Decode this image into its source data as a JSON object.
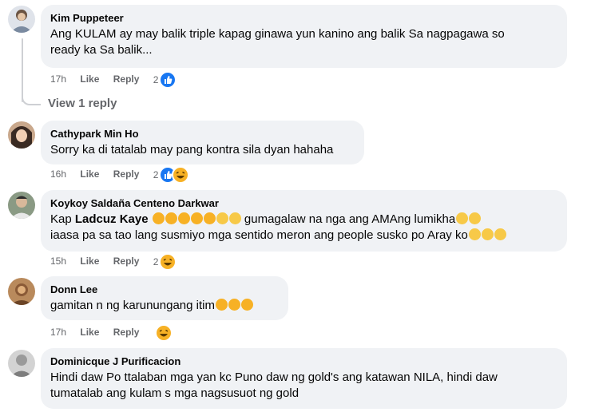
{
  "comments": [
    {
      "author": "Kim Puppeteer",
      "line1": "Ang KULAM ay may balik triple kapag ginawa yun kanino ang balik Sa nagpagawa so",
      "line2": "ready ka Sa balik...",
      "time": "17h",
      "like": "Like",
      "reply": "Reply",
      "reaction_count": "2",
      "reactions": [
        "like-icon"
      ],
      "view_replies": "View 1 reply"
    },
    {
      "author": "Cathypark Min Ho",
      "line1": "Sorry ka di tatalab may pang kontra sila dyan hahaha",
      "time": "16h",
      "like": "Like",
      "reply": "Reply",
      "reaction_count": "2",
      "reactions": [
        "like-icon",
        "haha-icon"
      ]
    },
    {
      "author": "Koykoy Saldaña Centeno Darkwar",
      "line1_prefix": "Kap ",
      "mention": "Ladcuz Kaye",
      "line1_suffix": " gumagalaw na nga ang AMAng lumikha",
      "line2": "iaasa pa sa tao lang susmiyo mga sentido meron ang people susko po Aray ko",
      "time": "15h",
      "like": "Like",
      "reply": "Reply",
      "reaction_count": "2",
      "reactions": [
        "haha-icon"
      ]
    },
    {
      "author": "Donn Lee",
      "line1": "gamitan n ng karunungang itim",
      "time": "17h",
      "like": "Like",
      "reply": "Reply",
      "reactions": [
        "haha-icon"
      ]
    },
    {
      "author": "Dominicque J Purificacion",
      "line1": "Hindi daw Po ttalaban mga yan kc Puno daw ng gold's ang katawan NILA, hindi daw",
      "line2": "tumatalab ang kulam s mga nagsusuot ng gold"
    }
  ],
  "colors": {
    "bubble": "#f0f2f5",
    "meta": "#65676b",
    "like_blue": "#1877f2",
    "haha_yellow": "#f7b125"
  }
}
